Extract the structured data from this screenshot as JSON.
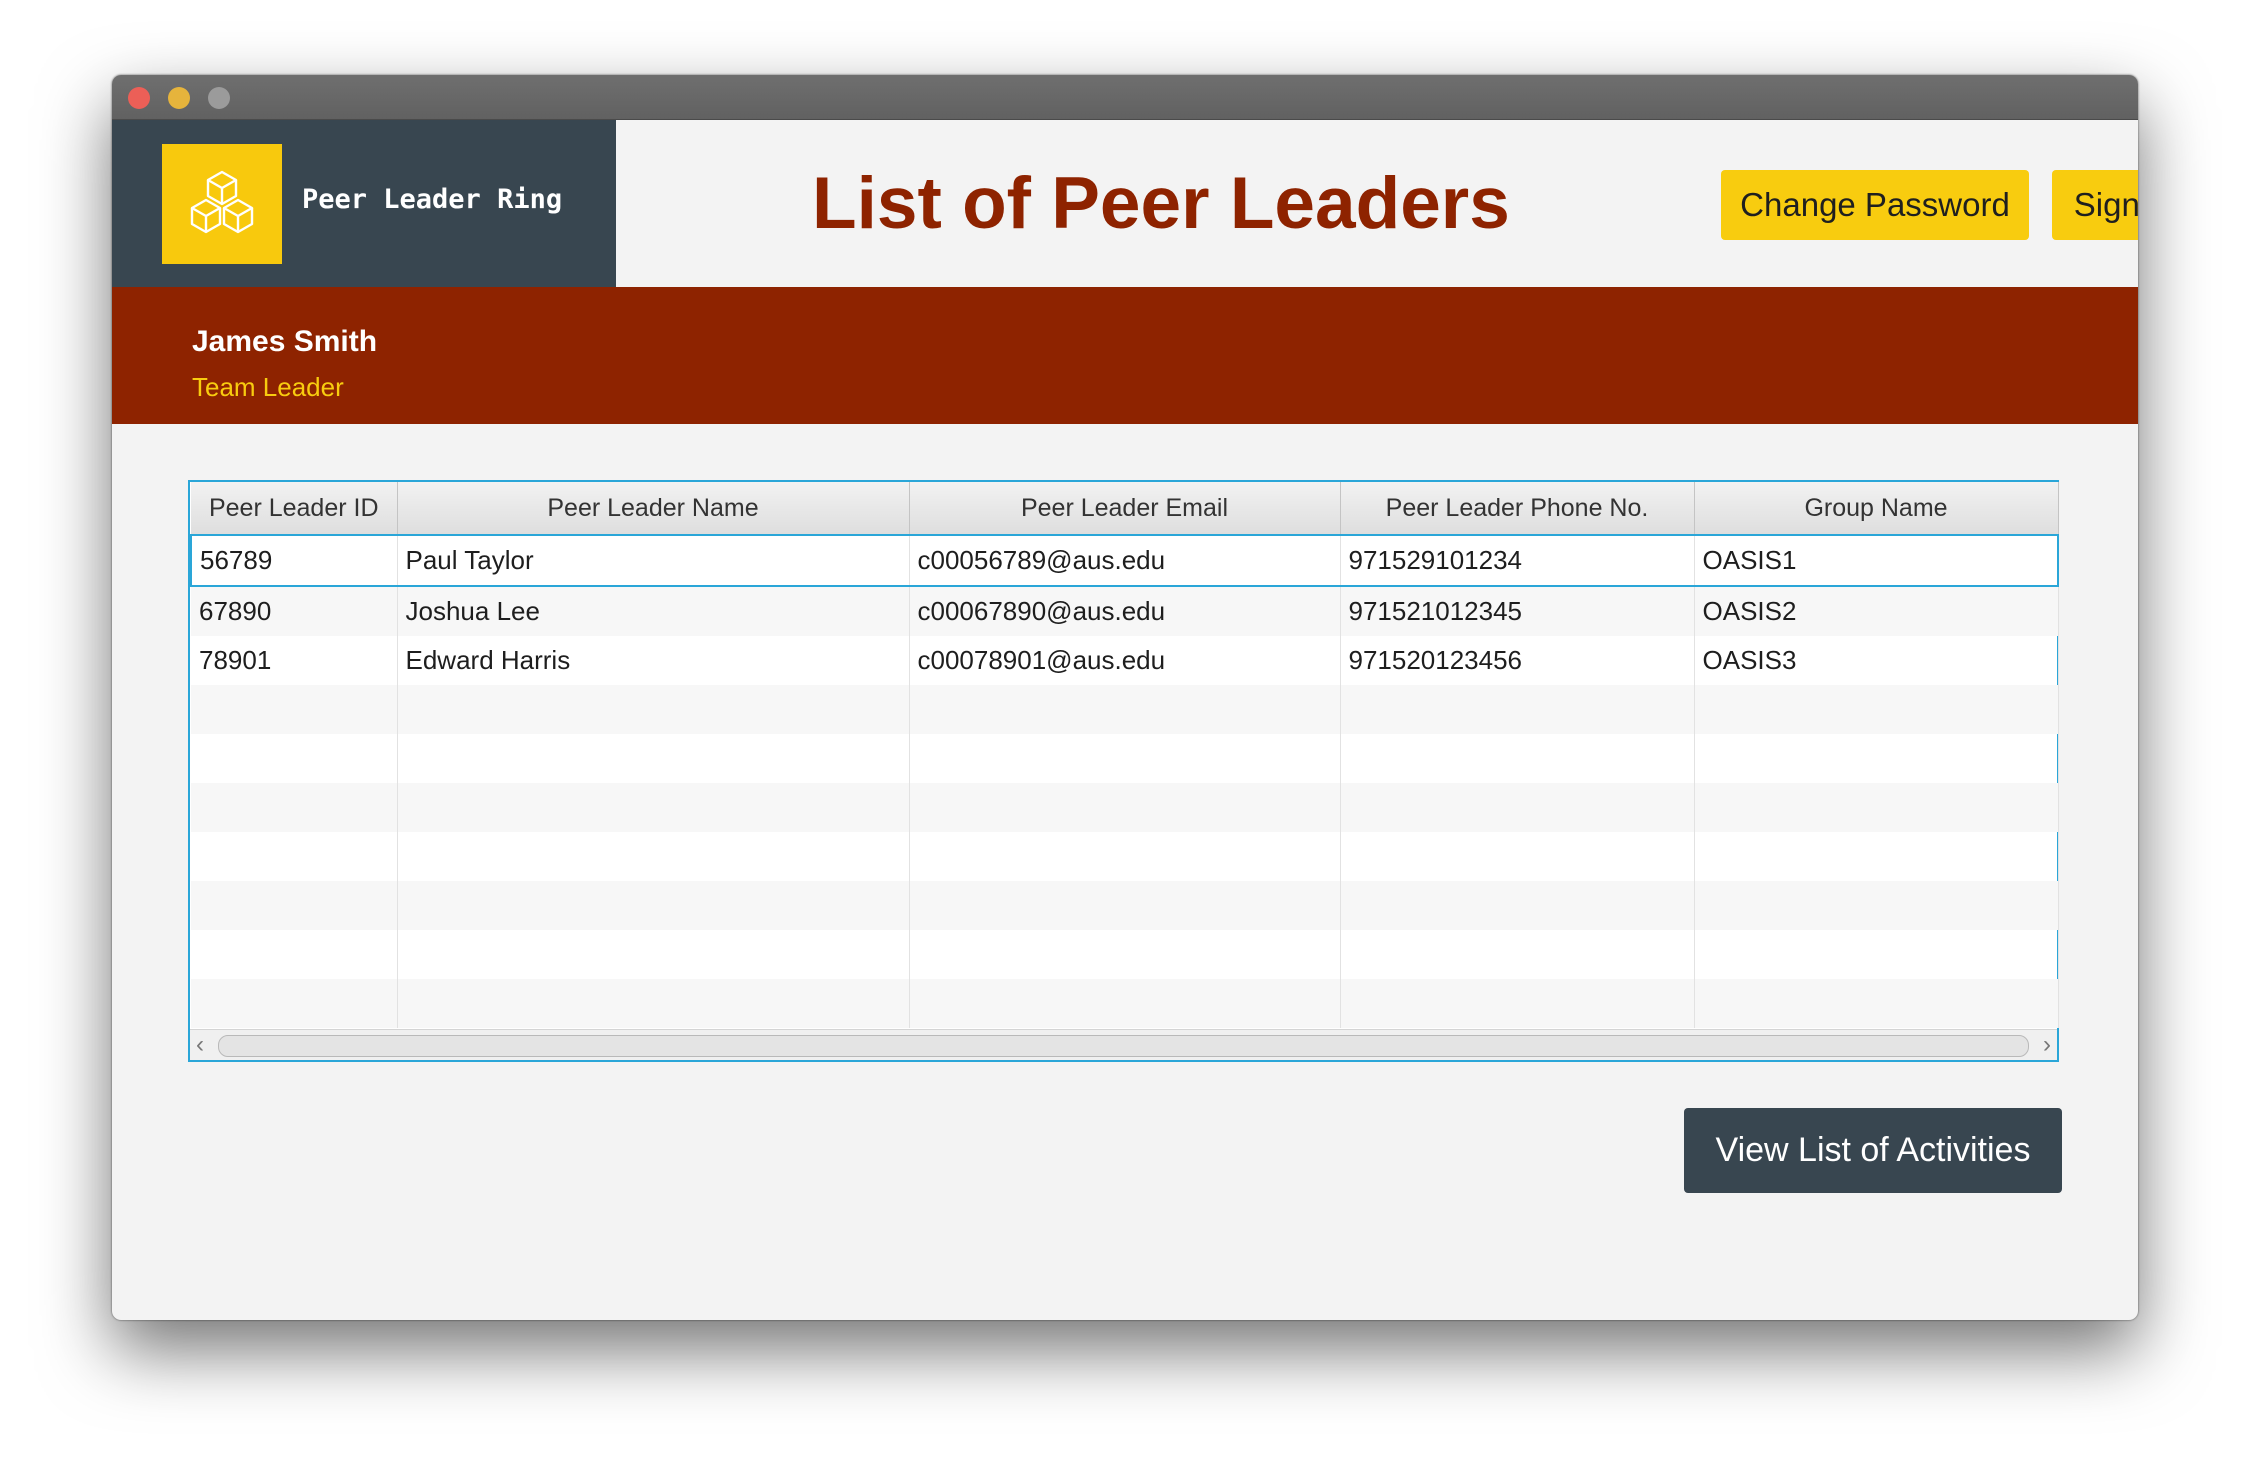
{
  "app": {
    "brand_name": "Peer Leader Ring",
    "logo_icon": "cubes-icon"
  },
  "header": {
    "title": "List of Peer Leaders",
    "change_password_label": "Change Password",
    "sign_out_label": "Sign Out"
  },
  "user": {
    "name": "James Smith",
    "role": "Team Leader"
  },
  "table": {
    "columns": [
      "Peer Leader ID",
      "Peer Leader Name",
      "Peer Leader Email",
      "Peer Leader Phone No.",
      "Group Name"
    ],
    "rows": [
      [
        "56789",
        "Paul Taylor",
        "c00056789@aus.edu",
        "971529101234",
        "OASIS1"
      ],
      [
        "67890",
        "Joshua Lee",
        "c00067890@aus.edu",
        "971521012345",
        "OASIS2"
      ],
      [
        "78901",
        "Edward Harris",
        "c00078901@aus.edu",
        "971520123456",
        "OASIS3"
      ]
    ],
    "selected_row": 0,
    "scroll_left_glyph": "‹",
    "scroll_right_glyph": "›"
  },
  "actions": {
    "view_activities_label": "View List of Activities"
  },
  "colors": {
    "accent_yellow": "#f8cc0f",
    "brand_dark": "#384650",
    "banner_red": "#8e2300",
    "selection_blue": "#2aa6d8"
  }
}
